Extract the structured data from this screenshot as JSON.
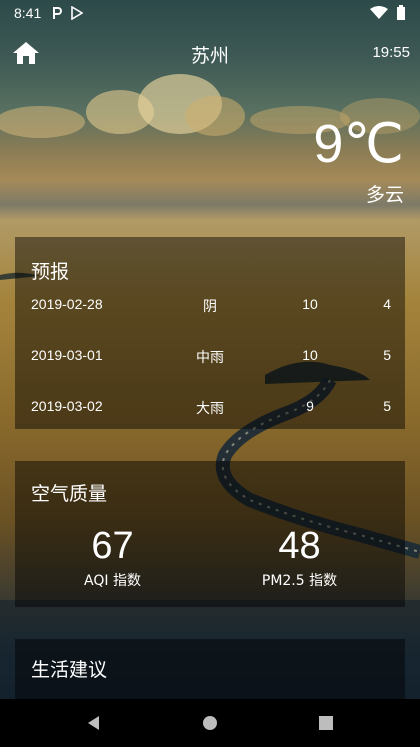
{
  "status_bar": {
    "time": "8:41",
    "left_icons": [
      "parking-icon",
      "play-store-icon"
    ],
    "right_icons": [
      "wifi-icon",
      "battery-icon"
    ]
  },
  "title_bar": {
    "city": "苏州",
    "update_time": "19:55"
  },
  "now": {
    "temperature": "9℃",
    "info": "多云"
  },
  "forecast": {
    "title": "预报",
    "items": [
      {
        "date": "2019-02-28",
        "info": "阴",
        "max": "10",
        "min": "4"
      },
      {
        "date": "2019-03-01",
        "info": "中雨",
        "max": "10",
        "min": "5"
      },
      {
        "date": "2019-03-02",
        "info": "大雨",
        "max": "9",
        "min": "5"
      }
    ]
  },
  "aqi": {
    "title": "空气质量",
    "aqi_value": "67",
    "aqi_label": "AQI 指数",
    "pm25_value": "48",
    "pm25_label": "PM2.5 指数"
  },
  "suggestion": {
    "title": "生活建议"
  },
  "nav_bar": {
    "buttons": [
      "back-icon",
      "home-circle-icon",
      "recents-square-icon"
    ]
  }
}
